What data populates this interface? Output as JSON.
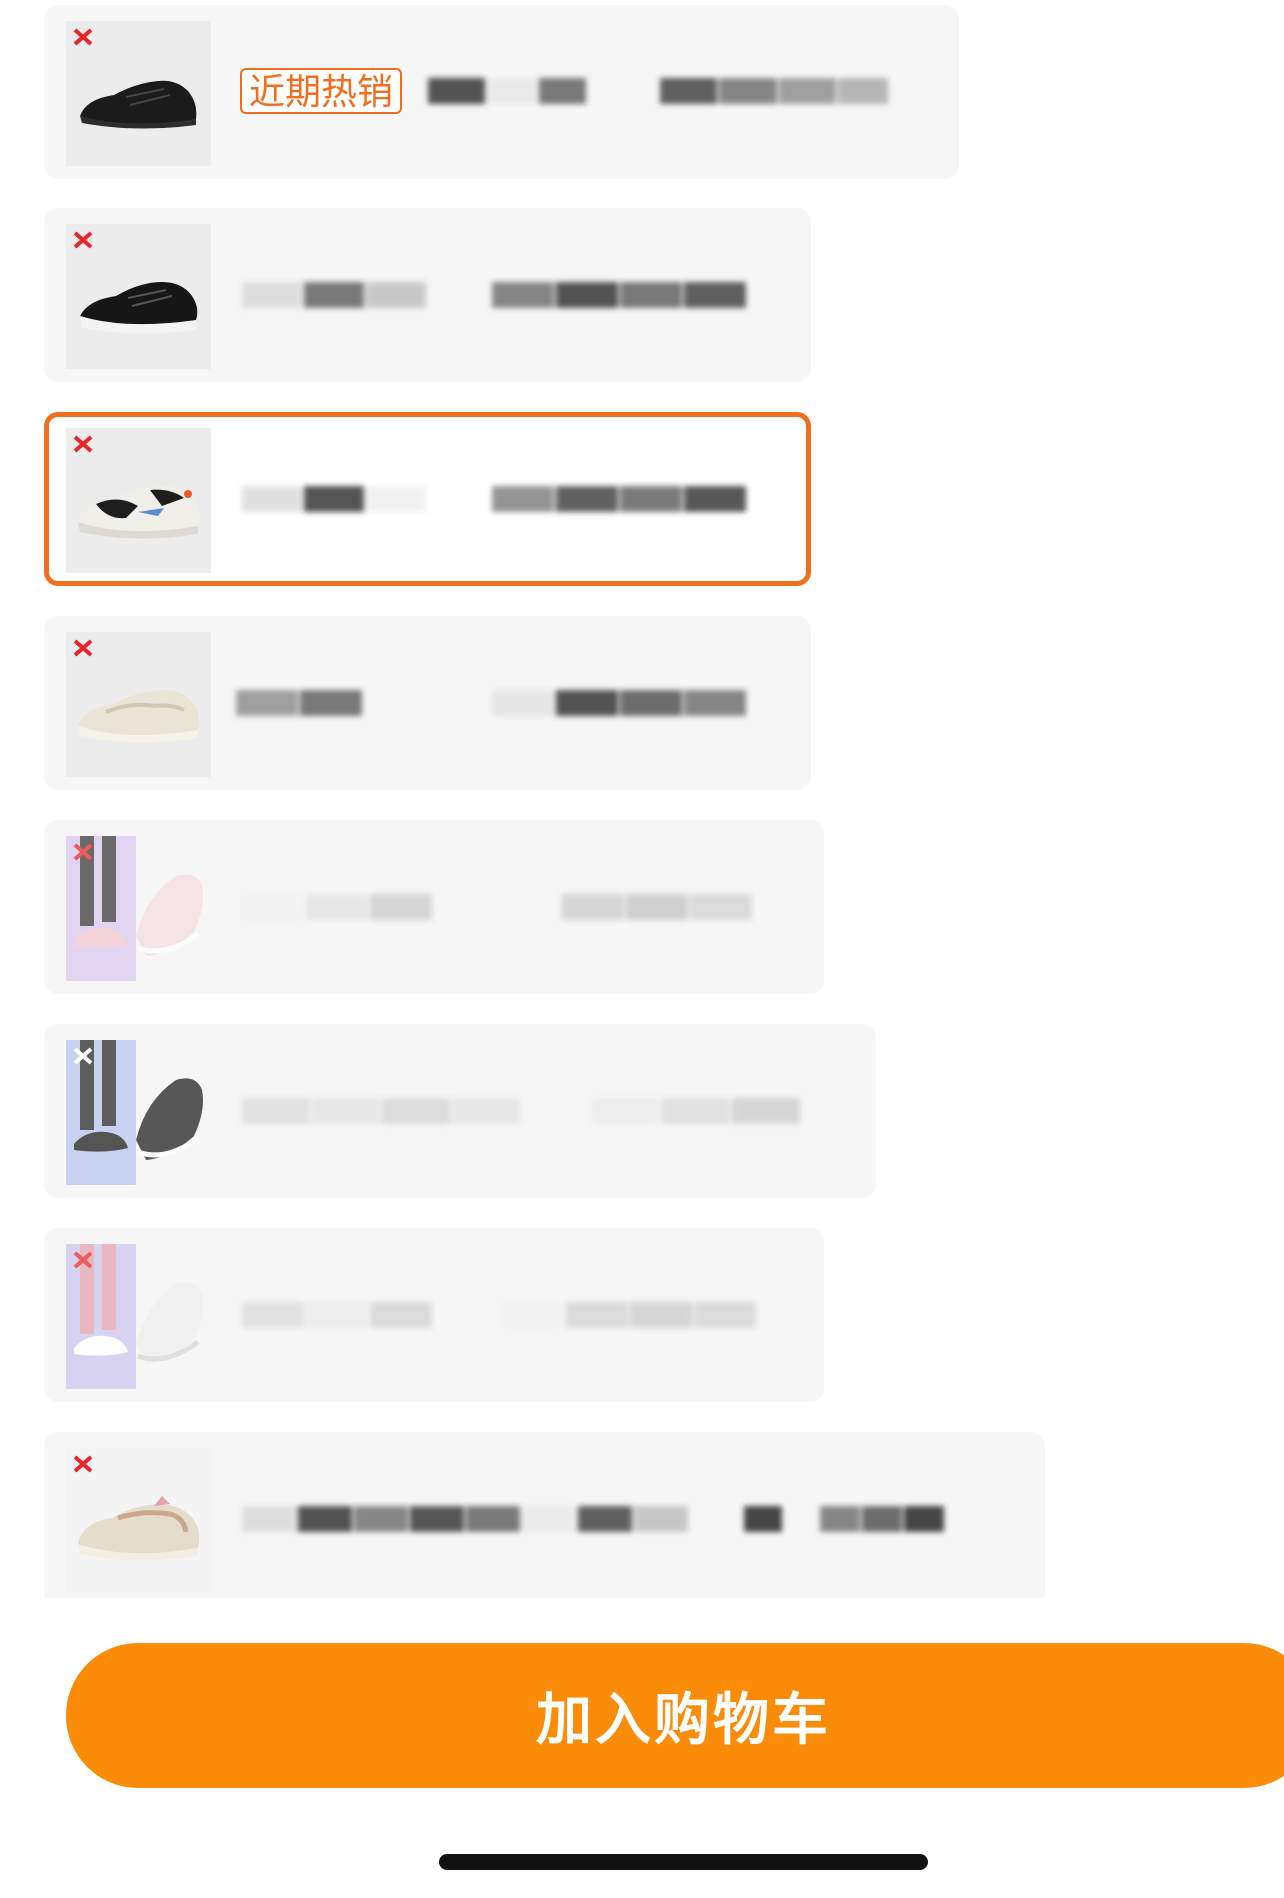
{
  "colors": {
    "accent_orange": "#f06e1d",
    "button_orange": "#fb8c0a",
    "card_bg": "#f6f6f6",
    "brand_red": "#e8262a"
  },
  "products": [
    {
      "image_icon": "black-running-shoe-icon",
      "tag": "近期热销",
      "selected": false,
      "faded": false
    },
    {
      "image_icon": "black-running-shoe-icon",
      "tag": "",
      "selected": false,
      "faded": false
    },
    {
      "image_icon": "white-black-running-shoe-icon",
      "tag": "",
      "selected": true,
      "faded": false
    },
    {
      "image_icon": "beige-running-shoe-icon",
      "tag": "",
      "selected": false,
      "faded": false
    },
    {
      "image_icon": "pink-shoe-with-model-icon",
      "tag": "",
      "selected": false,
      "faded": true
    },
    {
      "image_icon": "black-shoe-with-model-icon",
      "tag": "",
      "selected": false,
      "faded": true
    },
    {
      "image_icon": "white-shoe-with-model-icon",
      "tag": "",
      "selected": false,
      "faded": true
    },
    {
      "image_icon": "beige-retro-shoe-icon",
      "tag": "",
      "selected": false,
      "faded": false
    }
  ],
  "cart_button": {
    "label": "加入购物车"
  }
}
